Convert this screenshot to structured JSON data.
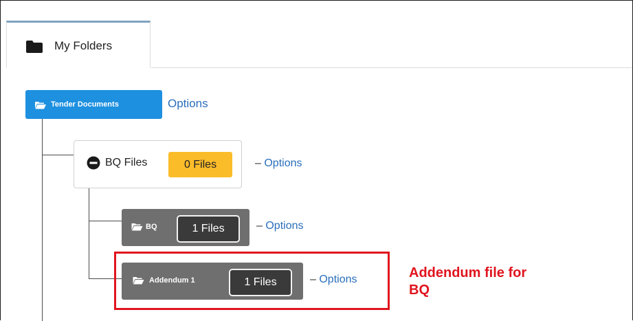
{
  "tab": {
    "label": "My Folders",
    "icon": "folder-icon"
  },
  "root": {
    "label": "Tender Documents",
    "options": "Options",
    "color": "#1e90e0"
  },
  "bq_files": {
    "label": "BQ Files",
    "count": "0 Files",
    "dash": "–",
    "options": "Options",
    "icon": "minus-circle-icon",
    "badge_color": "#fbbc2a"
  },
  "children": [
    {
      "label": "BQ",
      "count": "1 Files",
      "dash": "–",
      "options": "Options"
    },
    {
      "label": "Addendum 1",
      "count": "1 Files",
      "dash": "–",
      "options": "Options"
    }
  ],
  "annotation": {
    "line1": "Addendum file for",
    "line2": "BQ",
    "color": "#e0141e"
  }
}
